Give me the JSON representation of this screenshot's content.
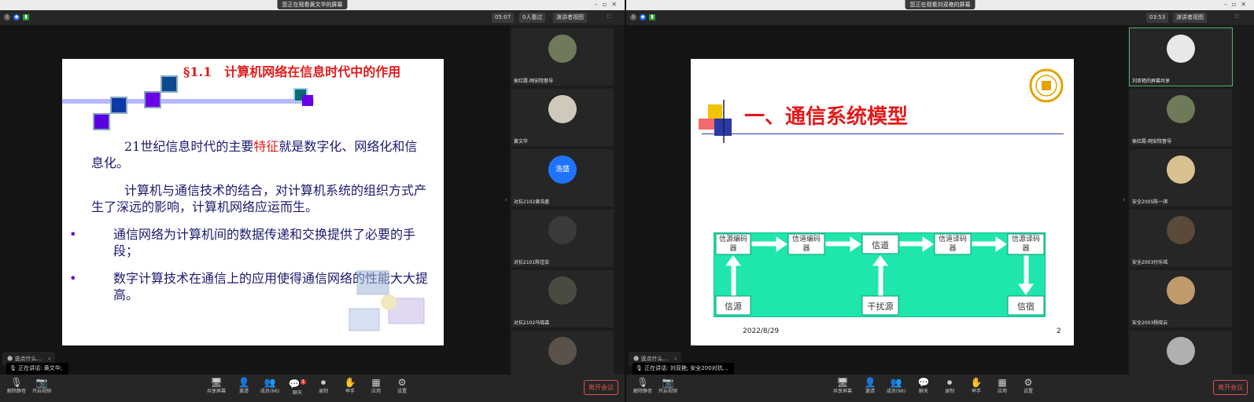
{
  "left": {
    "title": "您正在观看黄文华的屏幕",
    "timer": "05:07",
    "viewers": "0人看过",
    "view_mode": "演讲者视图",
    "chat_placeholder": "说点什么...",
    "speaking": "正在讲话: 黄文华;",
    "slide": {
      "heading": "§1.1　计算机网络在信息时代中的作用",
      "p1_a": "21世纪信息时代的主要",
      "p1_red": "特征",
      "p1_b": "就是数字化、网络化和信息化。",
      "p2": "计算机与通信技术的结合，对计算机系统的组织方式产生了深远的影响，计算机网络应运而生。",
      "bullets": [
        "通信网络为计算机间的数据传递和交换提供了必要的手段；",
        "数字计算技术在通信上的应用使得通信网络的性能大大提高。"
      ]
    },
    "participants": [
      {
        "name": "侯红霞-网安院督导",
        "avatar_color": "#6e7a5a"
      },
      {
        "name": "黄文华",
        "avatar_color": "#cfc9bb"
      },
      {
        "name": "浩盛",
        "initials": "浩盛",
        "avatar_color": "#1e74ff",
        "label": "对抗2102黄浩盛"
      },
      {
        "name": "对抗2101陈佳宏",
        "avatar_color": "#3a3a3a"
      },
      {
        "name": "对抗2102马晓森",
        "avatar_color": "#4a4a40"
      },
      {
        "name": "",
        "avatar_color": "#5a524a"
      }
    ],
    "toolbar": [
      "解除静音",
      "开启视频",
      "共享屏幕",
      "邀请",
      "成员(66)",
      "聊天",
      "录制",
      "举手",
      "应用",
      "设置"
    ],
    "chat_badge": "1",
    "leave": "离开会议"
  },
  "right": {
    "title": "您正在观看刘双艳的屏幕",
    "timer": "03:53",
    "view_mode": "演讲者视图",
    "chat_placeholder": "说点什么...",
    "speaking": "正在讲话: 刘双艳; 安全200对抗...",
    "slide": {
      "heading": "一、通信系统模型",
      "boxes": [
        "信源编码器",
        "信道编码器",
        "信道",
        "信道译码器",
        "信源译码器",
        "信源",
        "干扰源",
        "信宿"
      ],
      "date": "2022/8/29",
      "page": "2"
    },
    "participants": [
      {
        "name": "刘双艳的屏幕共享",
        "avatar_color": "#e8e8e8"
      },
      {
        "name": "侯红霞-网安院督导",
        "avatar_color": "#6e7a5a"
      },
      {
        "name": "安全2005陈一琪",
        "avatar_color": "#d8c090"
      },
      {
        "name": "安全2003付乐瑶",
        "avatar_color": "#5a4a3a"
      },
      {
        "name": "安全2003杨晓云",
        "avatar_color": "#c09a6a"
      },
      {
        "name": "",
        "avatar_color": "#b0b0b0"
      }
    ],
    "toolbar": [
      "解除静音",
      "开启视频",
      "共享屏幕",
      "邀请",
      "成员(96)",
      "聊天",
      "录制",
      "举手",
      "应用",
      "设置"
    ],
    "leave": "离开会议"
  }
}
